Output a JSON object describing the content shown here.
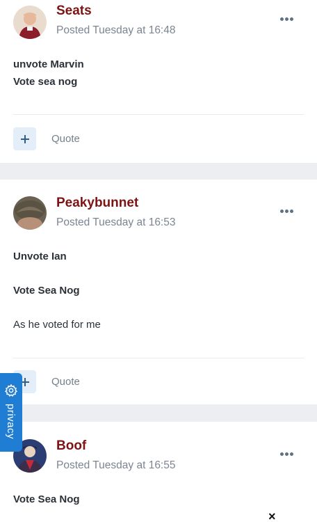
{
  "posts": [
    {
      "author": "Seats",
      "posted": "Posted Tuesday at 16:48",
      "lines": [
        "unvote Marvin",
        "Vote sea nog"
      ],
      "quote_label": "Quote"
    },
    {
      "author": "Peakybunnet",
      "posted": "Posted Tuesday at 16:53",
      "lines": [
        "Unvote Ian",
        "Vote Sea Nog",
        "As he voted for me"
      ],
      "quote_label": "Quote"
    },
    {
      "author": "Boof",
      "posted": "Posted Tuesday at 16:55",
      "lines": [
        "Vote Sea Nog"
      ]
    }
  ],
  "privacy": {
    "label": "privacy",
    "icon": "gear-icon"
  },
  "close": {
    "label": "×",
    "icon": "close-icon"
  },
  "colors": {
    "author": "#7d1313",
    "accent": "#1f7ed3",
    "background": "#eceef1"
  }
}
